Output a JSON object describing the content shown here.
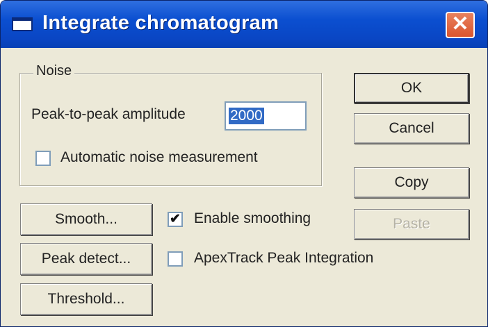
{
  "window": {
    "title": "Integrate chromatogram",
    "close_label": "✕"
  },
  "noise_group": {
    "legend": "Noise",
    "amplitude_label": "Peak-to-peak amplitude",
    "amplitude_value": "2000",
    "auto_label": "Automatic noise measurement",
    "auto_checked": false
  },
  "buttons": {
    "ok": "OK",
    "cancel": "Cancel",
    "copy": "Copy",
    "paste": "Paste",
    "smooth": "Smooth...",
    "peak_detect": "Peak detect...",
    "threshold": "Threshold..."
  },
  "options": {
    "enable_smoothing": {
      "label": "Enable smoothing",
      "checked": true,
      "mark": "✔"
    },
    "apextrack": {
      "label": "ApexTrack Peak Integration",
      "checked": false,
      "mark": ""
    }
  },
  "colors": {
    "titlebar": "#0B4FD0",
    "close": "#D9552F",
    "face": "#ECE9D8",
    "selection": "#316AC5"
  }
}
